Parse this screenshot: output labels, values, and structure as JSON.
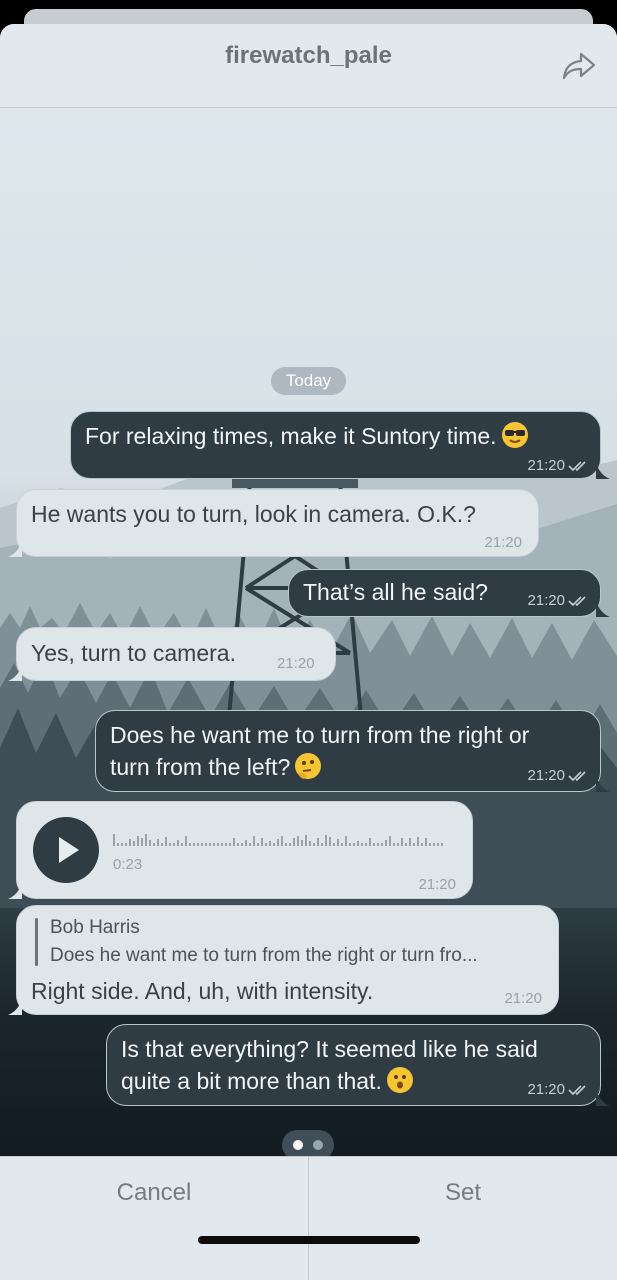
{
  "header": {
    "title": "firewatch_pale"
  },
  "chat": {
    "date_label": "Today",
    "messages": [
      {
        "text": "For relaxing times, make it Suntory time.",
        "time": "21:20"
      },
      {
        "text": "He wants you to turn, look in camera. O.K.?",
        "time": "21:20"
      },
      {
        "text": "That’s all he said?",
        "time": "21:20"
      },
      {
        "text": "Yes, turn to camera.",
        "time": "21:20"
      },
      {
        "line1": "Does he want me to turn from the right or",
        "line2": "turn from the left?",
        "time": "21:20"
      },
      {
        "duration": "0:23",
        "time": "21:20"
      },
      {
        "reply_author": "Bob Harris",
        "reply_text": "Does he want me to turn from the right or turn fro...",
        "text": "Right side. And, uh, with intensity.",
        "time": "21:20"
      },
      {
        "line1": "Is that everything? It seemed like he said",
        "line2": "quite a bit more than that.",
        "time": "21:20"
      }
    ]
  },
  "footer": {
    "cancel_label": "Cancel",
    "set_label": "Set"
  },
  "colors": {
    "outgoing_bubble": "#2f3c44",
    "incoming_bubble": "#dfe6ea",
    "header_bg": "#e2e9ee"
  },
  "icons": {
    "share": "share-arrow-icon",
    "read": "double-check-icon",
    "play": "play-icon"
  }
}
